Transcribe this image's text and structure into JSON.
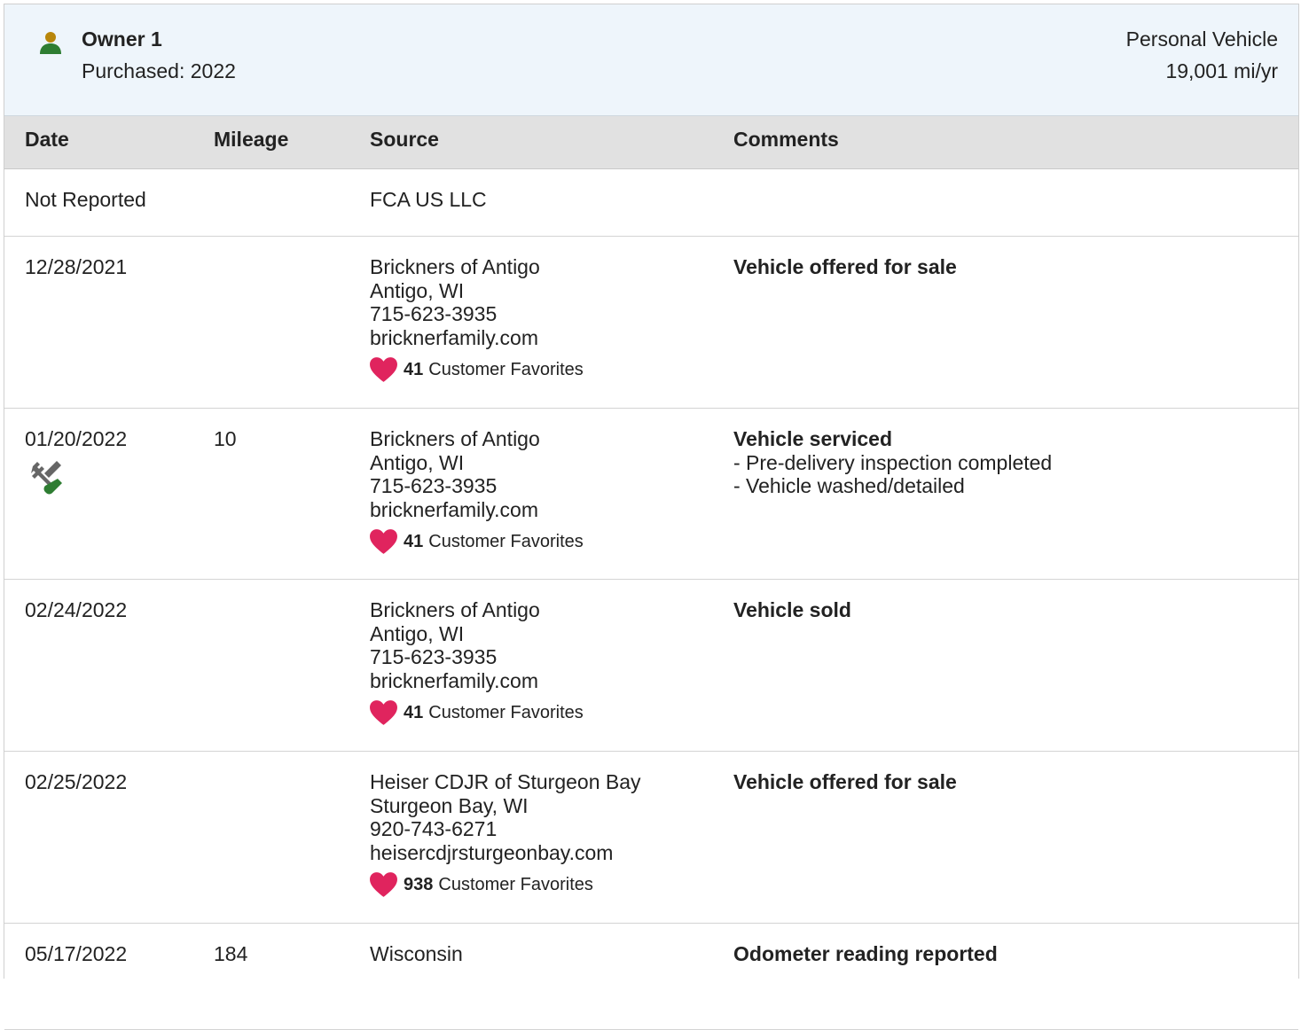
{
  "owner": {
    "title": "Owner 1",
    "purchased": "Purchased: 2022",
    "usage": "Personal Vehicle",
    "miles_per_year": "19,001 mi/yr",
    "icon": "person-icon",
    "icon_color": "#2e7d32",
    "icon_head_color": "#b8860b"
  },
  "table": {
    "headers": {
      "date": "Date",
      "mileage": "Mileage",
      "source": "Source",
      "comments": "Comments"
    },
    "rows": [
      {
        "date": "Not Reported",
        "mileage": "",
        "source": {
          "name": "FCA US LLC"
        },
        "comments": {
          "title": "",
          "lines": []
        }
      },
      {
        "date": "12/28/2021",
        "mileage": "",
        "source": {
          "name": "Brickners of Antigo",
          "location": "Antigo, WI",
          "phone": "715-623-3935",
          "website": "bricknerfamily.com",
          "favorites_count": "41",
          "favorites_label": "Customer Favorites"
        },
        "comments": {
          "title": "Vehicle offered for sale",
          "lines": []
        }
      },
      {
        "date": "01/20/2022",
        "mileage": "10",
        "service_icon": "wrench-screwdriver-icon",
        "source": {
          "name": "Brickners of Antigo",
          "location": "Antigo, WI",
          "phone": "715-623-3935",
          "website": "bricknerfamily.com",
          "favorites_count": "41",
          "favorites_label": "Customer Favorites"
        },
        "comments": {
          "title": "Vehicle serviced",
          "lines": [
            "- Pre-delivery inspection completed",
            "- Vehicle washed/detailed"
          ]
        }
      },
      {
        "date": "02/24/2022",
        "mileage": "",
        "source": {
          "name": "Brickners of Antigo",
          "location": "Antigo, WI",
          "phone": "715-623-3935",
          "website": "bricknerfamily.com",
          "favorites_count": "41",
          "favorites_label": "Customer Favorites"
        },
        "comments": {
          "title": "Vehicle sold",
          "lines": []
        }
      },
      {
        "date": "02/25/2022",
        "mileage": "",
        "source": {
          "name": "Heiser CDJR of Sturgeon Bay",
          "location": "Sturgeon Bay, WI",
          "phone": "920-743-6271",
          "website": "heisercdjrsturgeonbay.com",
          "favorites_count": "938",
          "favorites_label": "Customer Favorites"
        },
        "comments": {
          "title": "Vehicle offered for sale",
          "lines": []
        }
      },
      {
        "date": "05/17/2022",
        "mileage": "184",
        "source": {
          "name": "Wisconsin"
        },
        "comments": {
          "title": "Odometer reading reported",
          "lines": []
        }
      }
    ]
  },
  "colors": {
    "heart": "#e0245e",
    "header_bg": "#eef5fb",
    "table_header_bg": "#e1e1e1",
    "wrench": "#666666",
    "screwdriver": "#2e7d32"
  }
}
